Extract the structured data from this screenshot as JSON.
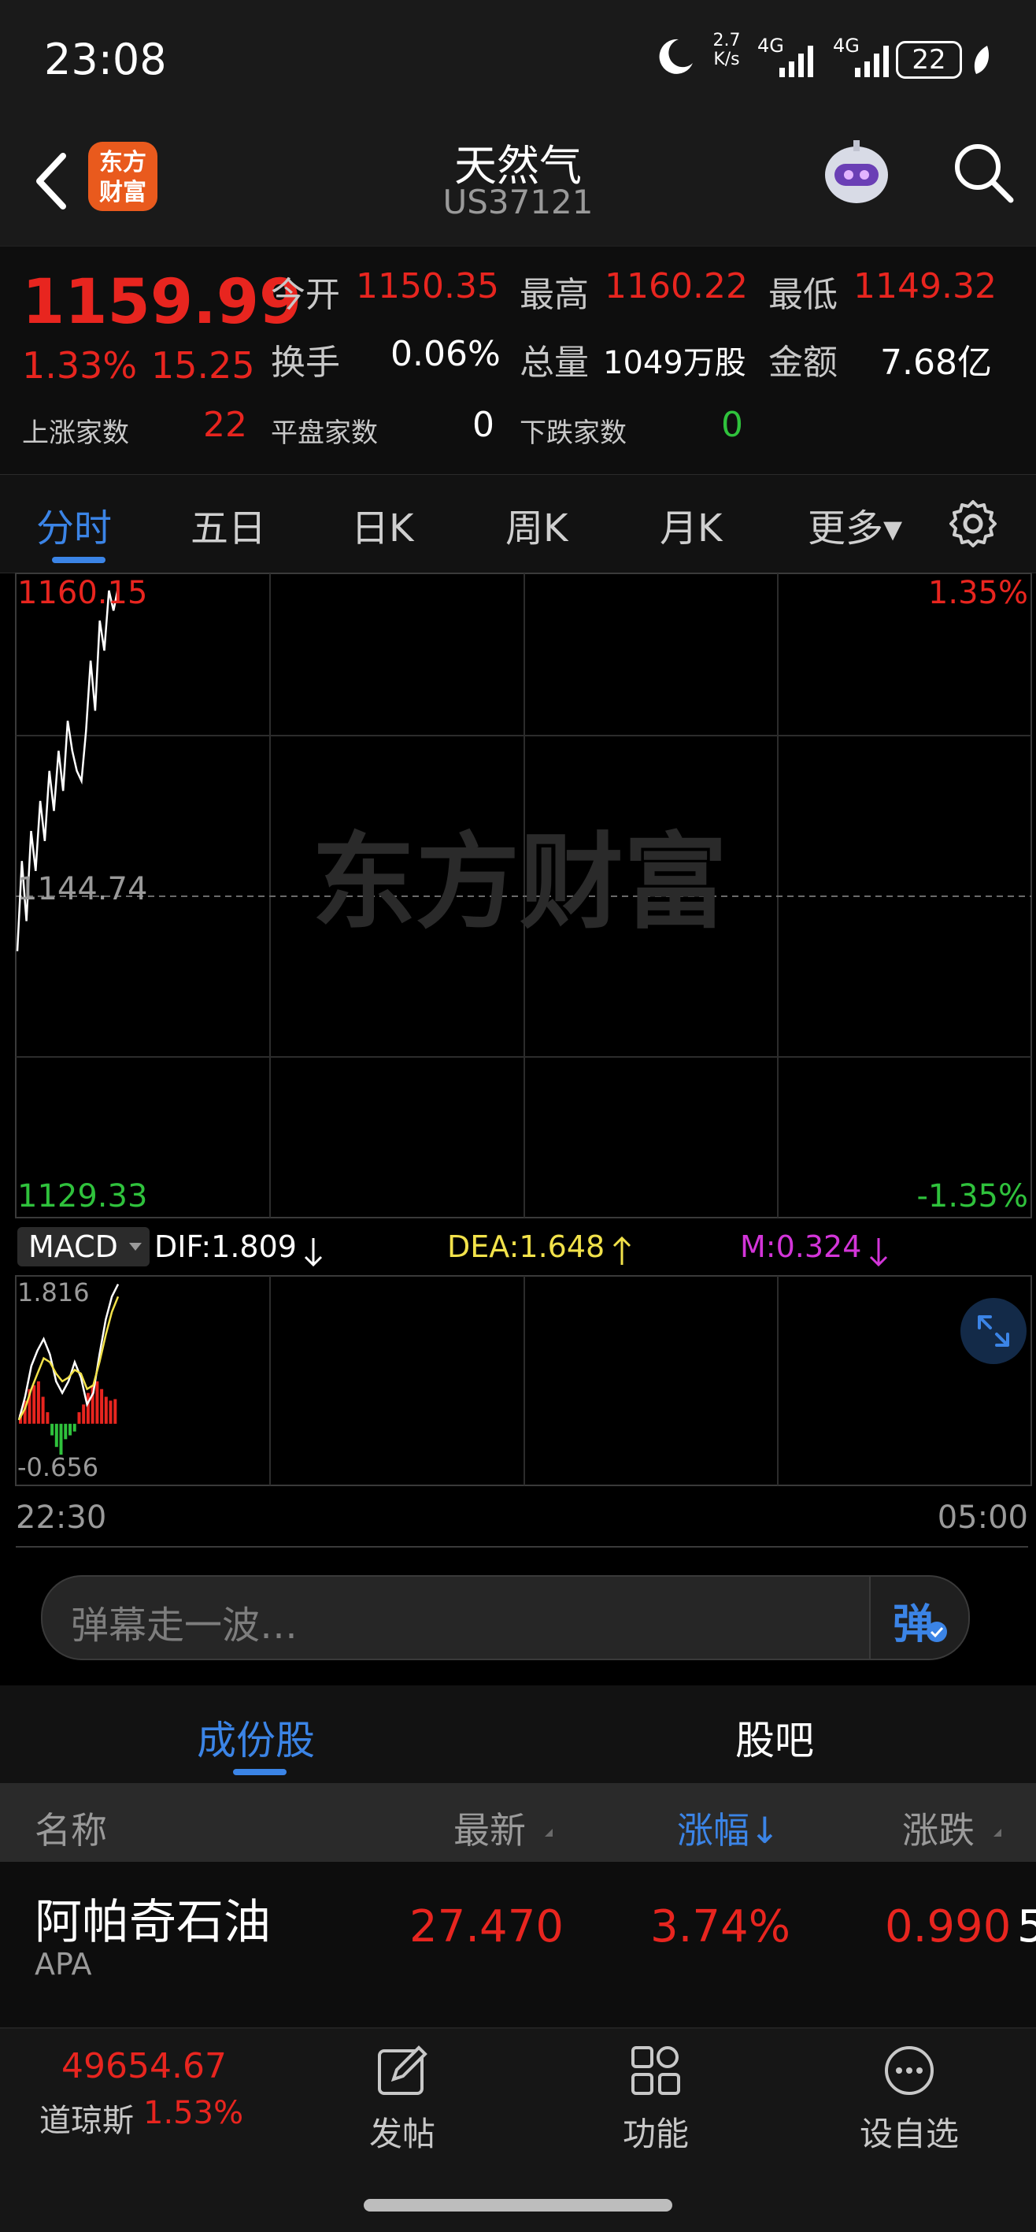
{
  "status_bar": {
    "time": "23:08",
    "net_speed_top": "2.7",
    "net_speed_unit": "K/s",
    "net1": "4G",
    "net2": "4G",
    "battery": "22"
  },
  "header": {
    "logo_text_1": "东方",
    "logo_text_2": "财富",
    "title": "天然气",
    "code": "US37121"
  },
  "quote": {
    "price": "1159.99",
    "change_pct": "1.33%",
    "change": "15.25",
    "open_label": "今开",
    "open": "1150.35",
    "high_label": "最高",
    "high": "1160.22",
    "low_label": "最低",
    "low": "1149.32",
    "turnover_label": "换手",
    "turnover": "0.06%",
    "volume_label": "总量",
    "volume": "1049万股",
    "amount_label": "金额",
    "amount": "7.68亿",
    "up_label": "上涨家数",
    "up_count": "22",
    "flat_label": "平盘家数",
    "flat_count": "0",
    "down_label": "下跌家数",
    "down_count": "0"
  },
  "tabs": [
    "分时",
    "五日",
    "日K",
    "周K",
    "月K",
    "更多▾"
  ],
  "chart_data": {
    "type": "line",
    "title": "",
    "y_top_label": "1160.15",
    "y_mid_label": "1144.74",
    "y_bottom_label": "1129.33",
    "pct_top_label": "1.35%",
    "pct_bottom_label": "-1.35%",
    "ylim": [
      1129.33,
      1160.15
    ],
    "watermark": "东方财富",
    "x_start_label": "22:30",
    "x_end_label": "05:00",
    "series": [
      {
        "values": [
          1142.0,
          1146.5,
          1143.5,
          1148.0,
          1146.0,
          1149.5,
          1147.5,
          1151.0,
          1149.0,
          1152.0,
          1150.0,
          1153.5,
          1152.0,
          1151.0,
          1150.5,
          1153.0,
          1156.5,
          1154.0,
          1158.5,
          1157.0,
          1160.0,
          1159.0,
          1160.15
        ]
      }
    ],
    "macd": {
      "selector_label": "MACD",
      "dif_label": "DIF:1.809",
      "dea_label": "DEA:1.648",
      "m_label": "M:0.324",
      "top_label": "1.816",
      "bottom_label": "-0.656",
      "ylim": [
        -0.656,
        1.816
      ],
      "dif": [
        0.05,
        0.35,
        0.75,
        0.95,
        1.1,
        0.9,
        0.55,
        0.4,
        0.55,
        0.8,
        0.6,
        0.25,
        0.4,
        0.9,
        1.35,
        1.65,
        1.81
      ],
      "dea": [
        0.05,
        0.2,
        0.45,
        0.65,
        0.85,
        0.8,
        0.65,
        0.55,
        0.6,
        0.7,
        0.65,
        0.45,
        0.5,
        0.8,
        1.15,
        1.45,
        1.65
      ],
      "bars": [
        0.12,
        0.3,
        0.45,
        0.5,
        0.55,
        0.35,
        0.15,
        -0.15,
        -0.3,
        -0.4,
        -0.2,
        -0.15,
        -0.1,
        0.15,
        0.25,
        0.4,
        0.5,
        0.55,
        0.45,
        0.35,
        0.3,
        0.32
      ]
    }
  },
  "danmu": {
    "placeholder": "弹幕走一波…",
    "button_label": "弹"
  },
  "sub_tabs": [
    "成份股",
    "股吧"
  ],
  "table": {
    "headers": [
      "名称",
      "最新",
      "涨幅↓",
      "涨跌"
    ],
    "rows": [
      {
        "name": "阿帕奇石油",
        "code": "APA",
        "latest": "27.470",
        "change_pct": "3.74%",
        "change": "0.990",
        "extra": "5"
      }
    ]
  },
  "bottom_nav": {
    "index_value": "49654.67",
    "index_name": "道琼斯",
    "index_pct": "1.53%",
    "items": [
      "发帖",
      "功能",
      "设自选"
    ]
  },
  "colors": {
    "up": "#e8251f",
    "down": "#2fc23c",
    "accent": "#3b84e6"
  }
}
